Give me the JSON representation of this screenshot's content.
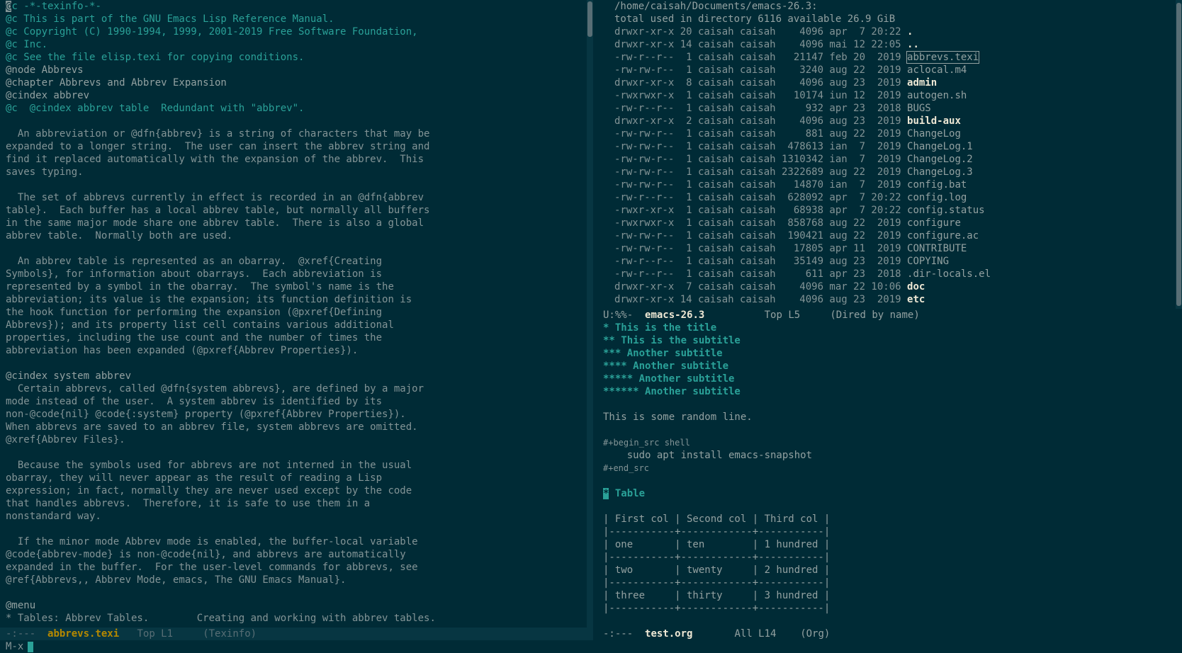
{
  "left_buffer": {
    "lines": [
      {
        "t": "@c -*-texinfo-*-",
        "k": "comment"
      },
      {
        "t": "@c This is part of the GNU Emacs Lisp Reference Manual.",
        "k": "comment"
      },
      {
        "t": "@c Copyright (C) 1990-1994, 1999, 2001-2019 Free Software Foundation,",
        "k": "comment"
      },
      {
        "t": "@c Inc.",
        "k": "comment"
      },
      {
        "t": "@c See the file elisp.texi for copying conditions.",
        "k": "comment"
      },
      {
        "t": "@node Abbrevs",
        "k": "cmd"
      },
      {
        "t": "@chapter Abbrevs and Abbrev Expansion",
        "k": "cmd"
      },
      {
        "t": "@cindex abbrev",
        "k": "cmd"
      },
      {
        "t": "@c  @cindex abbrev table  Redundant with \"abbrev\".",
        "k": "comment"
      },
      {
        "t": "",
        "k": "text"
      },
      {
        "t": "  An abbreviation or @dfn{abbrev} is a string of characters that may be",
        "k": "text"
      },
      {
        "t": "expanded to a longer string.  The user can insert the abbrev string and",
        "k": "text"
      },
      {
        "t": "find it replaced automatically with the expansion of the abbrev.  This",
        "k": "text"
      },
      {
        "t": "saves typing.",
        "k": "text"
      },
      {
        "t": "",
        "k": "text"
      },
      {
        "t": "  The set of abbrevs currently in effect is recorded in an @dfn{abbrev",
        "k": "text"
      },
      {
        "t": "table}.  Each buffer has a local abbrev table, but normally all buffers",
        "k": "text"
      },
      {
        "t": "in the same major mode share one abbrev table.  There is also a global",
        "k": "text"
      },
      {
        "t": "abbrev table.  Normally both are used.",
        "k": "text"
      },
      {
        "t": "",
        "k": "text"
      },
      {
        "t": "  An abbrev table is represented as an obarray.  @xref{Creating",
        "k": "text"
      },
      {
        "t": "Symbols}, for information about obarrays.  Each abbreviation is",
        "k": "text"
      },
      {
        "t": "represented by a symbol in the obarray.  The symbol's name is the",
        "k": "text"
      },
      {
        "t": "abbreviation; its value is the expansion; its function definition is",
        "k": "text"
      },
      {
        "t": "the hook function for performing the expansion (@pxref{Defining",
        "k": "text"
      },
      {
        "t": "Abbrevs}); and its property list cell contains various additional",
        "k": "text"
      },
      {
        "t": "properties, including the use count and the number of times the",
        "k": "text"
      },
      {
        "t": "abbreviation has been expanded (@pxref{Abbrev Properties}).",
        "k": "text"
      },
      {
        "t": "",
        "k": "text"
      },
      {
        "t": "@cindex system abbrev",
        "k": "cmd"
      },
      {
        "t": "  Certain abbrevs, called @dfn{system abbrevs}, are defined by a major",
        "k": "text"
      },
      {
        "t": "mode instead of the user.  A system abbrev is identified by its",
        "k": "text"
      },
      {
        "t": "non-@code{nil} @code{:system} property (@pxref{Abbrev Properties}).",
        "k": "text"
      },
      {
        "t": "When abbrevs are saved to an abbrev file, system abbrevs are omitted.",
        "k": "text"
      },
      {
        "t": "@xref{Abbrev Files}.",
        "k": "text"
      },
      {
        "t": "",
        "k": "text"
      },
      {
        "t": "  Because the symbols used for abbrevs are not interned in the usual",
        "k": "text"
      },
      {
        "t": "obarray, they will never appear as the result of reading a Lisp",
        "k": "text"
      },
      {
        "t": "expression; in fact, normally they are never used except by the code",
        "k": "text"
      },
      {
        "t": "that handles abbrevs.  Therefore, it is safe to use them in a",
        "k": "text"
      },
      {
        "t": "nonstandard way.",
        "k": "text"
      },
      {
        "t": "",
        "k": "text"
      },
      {
        "t": "  If the minor mode Abbrev mode is enabled, the buffer-local variable",
        "k": "text"
      },
      {
        "t": "@code{abbrev-mode} is non-@code{nil}, and abbrevs are automatically",
        "k": "text"
      },
      {
        "t": "expanded in the buffer.  For the user-level commands for abbrevs, see",
        "k": "text"
      },
      {
        "t": "@ref{Abbrevs,, Abbrev Mode, emacs, The GNU Emacs Manual}.",
        "k": "text"
      },
      {
        "t": "",
        "k": "text"
      },
      {
        "t": "@menu",
        "k": "cmd"
      },
      {
        "t": "* Tables: Abbrev Tables.        Creating and working with abbrev tables.",
        "k": "text"
      }
    ]
  },
  "dired": {
    "path": "/home/caisah/Documents/emacs-26.3:",
    "summary": "total used in directory 6116 available 26.9 GiB",
    "entries": [
      {
        "meta": "drwxr-xr-x 20 caisah caisah    4096 apr  7 20:22",
        "name": ".",
        "kind": "dir"
      },
      {
        "meta": "drwxr-xr-x 14 caisah caisah    4096 mai 12 22:05",
        "name": "..",
        "kind": "dir"
      },
      {
        "meta": "-rw-r--r--  1 caisah caisah   21147 feb 20  2019",
        "name": "abbrevs.texi",
        "kind": "file",
        "cursor": true
      },
      {
        "meta": "-rw-rw-r--  1 caisah caisah    3240 aug 22  2019",
        "name": "aclocal.m4",
        "kind": "file"
      },
      {
        "meta": "drwxr-xr-x  8 caisah caisah    4096 aug 23  2019",
        "name": "admin",
        "kind": "dir"
      },
      {
        "meta": "-rwxrwxr-x  1 caisah caisah   10174 iun 12  2019",
        "name": "autogen.sh",
        "kind": "file"
      },
      {
        "meta": "-rw-r--r--  1 caisah caisah     932 apr 23  2018",
        "name": "BUGS",
        "kind": "file"
      },
      {
        "meta": "drwxr-xr-x  2 caisah caisah    4096 aug 23  2019",
        "name": "build-aux",
        "kind": "dir"
      },
      {
        "meta": "-rw-rw-r--  1 caisah caisah     881 aug 22  2019",
        "name": "ChangeLog",
        "kind": "file"
      },
      {
        "meta": "-rw-rw-r--  1 caisah caisah  478613 ian  7  2019",
        "name": "ChangeLog.1",
        "kind": "file"
      },
      {
        "meta": "-rw-rw-r--  1 caisah caisah 1310342 ian  7  2019",
        "name": "ChangeLog.2",
        "kind": "file"
      },
      {
        "meta": "-rw-rw-r--  1 caisah caisah 2322689 aug 22  2019",
        "name": "ChangeLog.3",
        "kind": "file"
      },
      {
        "meta": "-rw-rw-r--  1 caisah caisah   14870 ian  7  2019",
        "name": "config.bat",
        "kind": "file"
      },
      {
        "meta": "-rw-r--r--  1 caisah caisah  628092 apr  7 20:22",
        "name": "config.log",
        "kind": "file"
      },
      {
        "meta": "-rwxr-xr-x  1 caisah caisah   68938 apr  7 20:22",
        "name": "config.status",
        "kind": "file"
      },
      {
        "meta": "-rwxrwxr-x  1 caisah caisah  858768 aug 22  2019",
        "name": "configure",
        "kind": "file"
      },
      {
        "meta": "-rw-rw-r--  1 caisah caisah  190421 aug 22  2019",
        "name": "configure.ac",
        "kind": "file"
      },
      {
        "meta": "-rw-rw-r--  1 caisah caisah   17805 apr 11  2019",
        "name": "CONTRIBUTE",
        "kind": "file"
      },
      {
        "meta": "-rw-r--r--  1 caisah caisah   35149 aug 23  2019",
        "name": "COPYING",
        "kind": "file"
      },
      {
        "meta": "-rw-r--r--  1 caisah caisah     611 apr 23  2018",
        "name": ".dir-locals.el",
        "kind": "file"
      },
      {
        "meta": "drwxr-xr-x  7 caisah caisah    4096 mar 22 10:06",
        "name": "doc",
        "kind": "dir"
      },
      {
        "meta": "drwxr-xr-x 14 caisah caisah    4096 aug 23  2019",
        "name": "etc",
        "kind": "dir"
      }
    ]
  },
  "modelines": {
    "dired": {
      "status": "U:%%-  ",
      "buffer": "emacs-26.3",
      "pos": "Top L5",
      "mode": "(Dired by name)"
    },
    "left": {
      "status": "-:---  ",
      "buffer": "abbrevs.texi",
      "pos": "Top L1",
      "mode": "(Texinfo)"
    },
    "org": {
      "status": "-:---  ",
      "buffer": "test.org",
      "pos": "All L14",
      "mode": "(Org)"
    }
  },
  "org": {
    "headings": [
      "* This is the title",
      "** This is the subtitle",
      "*** Another subtitle",
      "**** Another subtitle",
      "***** Another subtitle",
      "****** Another subtitle"
    ],
    "random_line": "This is some random line.",
    "src_begin": "#+begin_src shell",
    "src_code": "    sudo apt install emacs-snapshot",
    "src_end": "#+end_src",
    "table_heading_star": "*",
    "table_heading": " Table",
    "table_lines": [
      "| First col | Second col | Third col |",
      "|-----------+------------+-----------|",
      "| one       | ten        | 1 hundred |",
      "|-----------+------------+-----------|",
      "| two       | twenty     | 2 hundred |",
      "|-----------+------------+-----------|",
      "| three     | thirty     | 3 hundred |",
      "|-----------+------------+-----------|"
    ]
  },
  "minibuffer": {
    "prompt": "M-x"
  },
  "colors": {
    "background": "#002b36",
    "modeline_active": "#073642",
    "accent": "#2aa198",
    "buffer_name": "#b58900"
  }
}
